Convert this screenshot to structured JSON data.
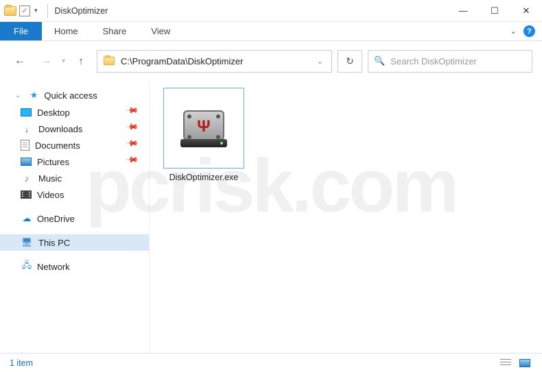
{
  "window": {
    "title": "DiskOptimizer"
  },
  "ribbon": {
    "file": "File",
    "tabs": [
      "Home",
      "Share",
      "View"
    ]
  },
  "nav": {
    "address": "C:\\ProgramData\\DiskOptimizer",
    "search_placeholder": "Search DiskOptimizer"
  },
  "sidebar": {
    "quick_access": "Quick access",
    "items": [
      {
        "label": "Desktop",
        "pinned": true
      },
      {
        "label": "Downloads",
        "pinned": true
      },
      {
        "label": "Documents",
        "pinned": true
      },
      {
        "label": "Pictures",
        "pinned": true
      },
      {
        "label": "Music",
        "pinned": false
      },
      {
        "label": "Videos",
        "pinned": false
      }
    ],
    "onedrive": "OneDrive",
    "thispc": "This PC",
    "network": "Network"
  },
  "files": [
    {
      "name": "DiskOptimizer.exe"
    }
  ],
  "status": {
    "count_text": "1 item"
  },
  "watermark": "pcrisk.com"
}
